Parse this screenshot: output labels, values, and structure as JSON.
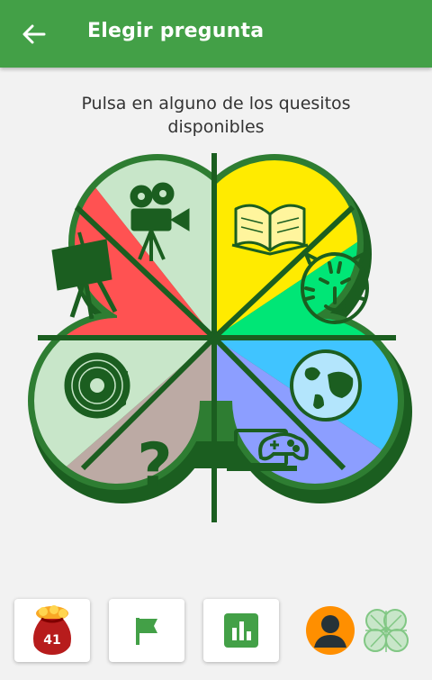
{
  "header": {
    "title": "Elegir pregunta",
    "background": "#43a047"
  },
  "instructions": "Pulsa en alguno de los quesitos disponibles",
  "wedges": [
    {
      "name": "cinema",
      "icon": "movie-camera-icon",
      "color": "#c8e6c9"
    },
    {
      "name": "literature",
      "icon": "book-icon",
      "color": "#ffeb00"
    },
    {
      "name": "nature",
      "icon": "tiger-icon",
      "color": "#00e676"
    },
    {
      "name": "geography",
      "icon": "globe-icon",
      "color": "#40c4ff"
    },
    {
      "name": "videogames",
      "icon": "laptop-gamepad-icon",
      "color": "#8c9eff"
    },
    {
      "name": "random",
      "icon": "question-mark-icon",
      "color": "#bcaaa4"
    },
    {
      "name": "music",
      "icon": "vinyl-record-icon",
      "color": "#c8e6c9"
    },
    {
      "name": "art",
      "icon": "easel-icon",
      "color": "#ff5252"
    }
  ],
  "bottom_bar": {
    "coins_count": "41",
    "buttons": [
      "coin-bag-icon",
      "flag-icon",
      "bar-chart-icon"
    ],
    "avatar_icon": "user-avatar-icon",
    "clover_icon": "clover-icon"
  }
}
